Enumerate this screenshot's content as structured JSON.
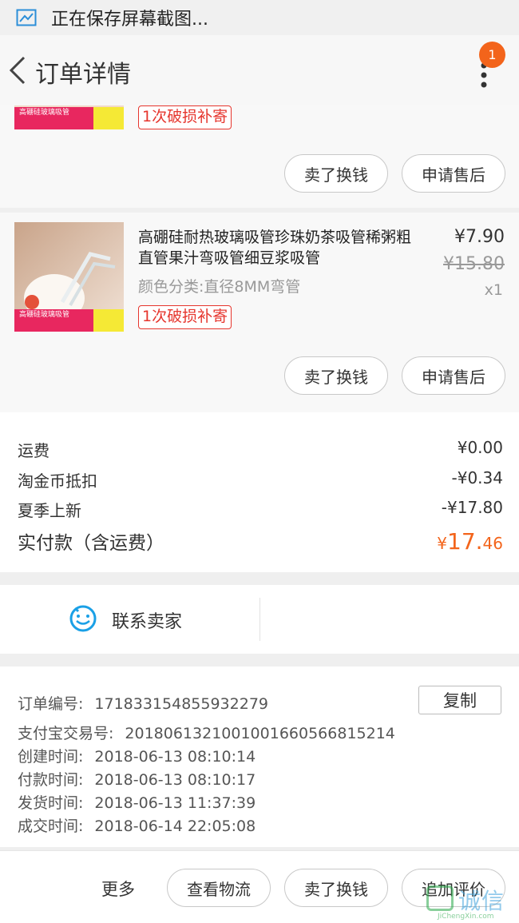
{
  "status_bar": {
    "text": "正在保存屏幕截图..."
  },
  "nav": {
    "title": "订单详情",
    "badge_count": "1"
  },
  "items": [
    {
      "tag": "1次破损补寄",
      "thumb_text": "高硼硅玻璃吸管",
      "actions": {
        "sell": "卖了换钱",
        "aftersale": "申请售后"
      }
    },
    {
      "title": "高硼硅耐热玻璃吸管珍珠奶茶吸管稀粥粗直管果汁弯吸管细豆浆吸管",
      "spec": "颜色分类:直径8MM弯管",
      "price": "¥7.90",
      "original_price": "¥15.80",
      "quantity": "x1",
      "tag": "1次破损补寄",
      "thumb_text": "高硼硅玻璃吸管",
      "actions": {
        "sell": "卖了换钱",
        "aftersale": "申请售后"
      }
    }
  ],
  "totals": {
    "shipping_label": "运费",
    "shipping_value": "¥0.00",
    "coin_label": "淘金币抵扣",
    "coin_value": "-¥0.34",
    "promo_label": "夏季上新",
    "promo_value": "-¥17.80",
    "paid_label": "实付款（含运费）",
    "paid_currency": "¥",
    "paid_int": "17.",
    "paid_dec": "46"
  },
  "contact": {
    "label": "联系卖家"
  },
  "order_info": {
    "order_no_label": "订单编号:",
    "order_no": "171833154855932279",
    "copy_label": "复制",
    "alipay_label": "支付宝交易号:",
    "alipay_no": "2018061321001001660566815214",
    "created_label": "创建时间:",
    "created": "2018-06-13 08:10:14",
    "paid_label": "付款时间:",
    "paid": "2018-06-13 08:10:17",
    "shipped_label": "发货时间:",
    "shipped": "2018-06-13 11:37:39",
    "completed_label": "成交时间:",
    "completed": "2018-06-14 22:05:08"
  },
  "bottom_bar": {
    "more": "更多",
    "logistics": "查看物流",
    "sell": "卖了换钱",
    "review": "追加评价"
  },
  "watermark": {
    "text": "诚信",
    "site": "JiChengXin.com"
  },
  "colors": {
    "accent": "#f3641b",
    "tag_red": "#e6352d",
    "contact_blue": "#1aa0e6"
  }
}
